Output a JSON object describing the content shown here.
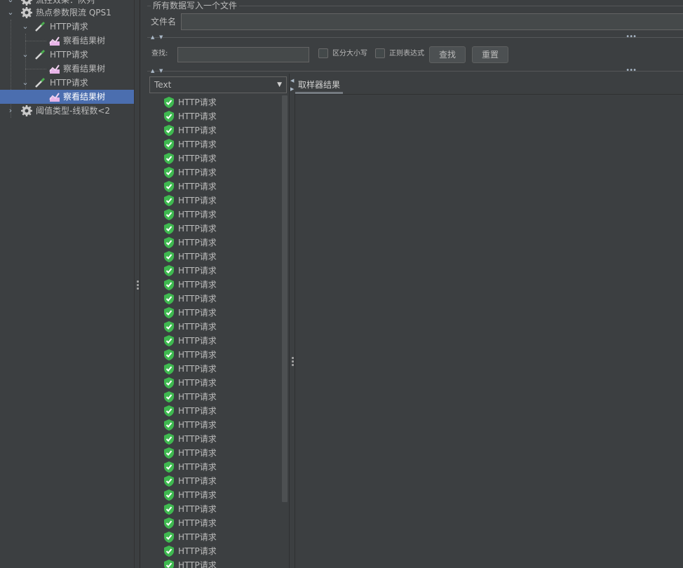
{
  "tree": {
    "items": [
      {
        "label": "流控效果：队列",
        "arrow": "chevron-down",
        "icon": "gear-icon"
      },
      {
        "label": "热点参数限流 QPS1",
        "arrow": "chevron-down",
        "icon": "gear-icon"
      },
      {
        "label": "HTTP请求",
        "arrow": "chevron-down",
        "icon": "pipette-icon"
      },
      {
        "label": "察看结果树",
        "icon": "chart-icon"
      },
      {
        "label": "HTTP请求",
        "arrow": "chevron-down",
        "icon": "pipette-icon"
      },
      {
        "label": "察看结果树",
        "icon": "chart-icon"
      },
      {
        "label": "HTTP请求",
        "arrow": "chevron-down",
        "icon": "pipette-icon"
      },
      {
        "label": "察看结果树",
        "icon": "chart-icon",
        "selected": true
      },
      {
        "label": "阈值类型-线程数<2",
        "arrow": "chevron-right",
        "icon": "gear-icon"
      }
    ]
  },
  "file_section": {
    "title": "所有数据写入一个文件",
    "filename_label": "文件名",
    "filename_value": ""
  },
  "search": {
    "label": "查找:",
    "value": "",
    "case_label": "区分大小写",
    "regex_label": "正则表达式",
    "find_button": "查找",
    "reset_button": "重置"
  },
  "renderer": {
    "selected": "Text"
  },
  "results": {
    "item_label": "HTTP请求",
    "status_icon": "green-shield-check-icon",
    "visible_count": 34
  },
  "tabs": [
    {
      "label": "取样器结果",
      "active": true
    }
  ],
  "colors": {
    "background": "#3c3f41",
    "selection": "#4b6eaf",
    "success": "#3fb950"
  }
}
